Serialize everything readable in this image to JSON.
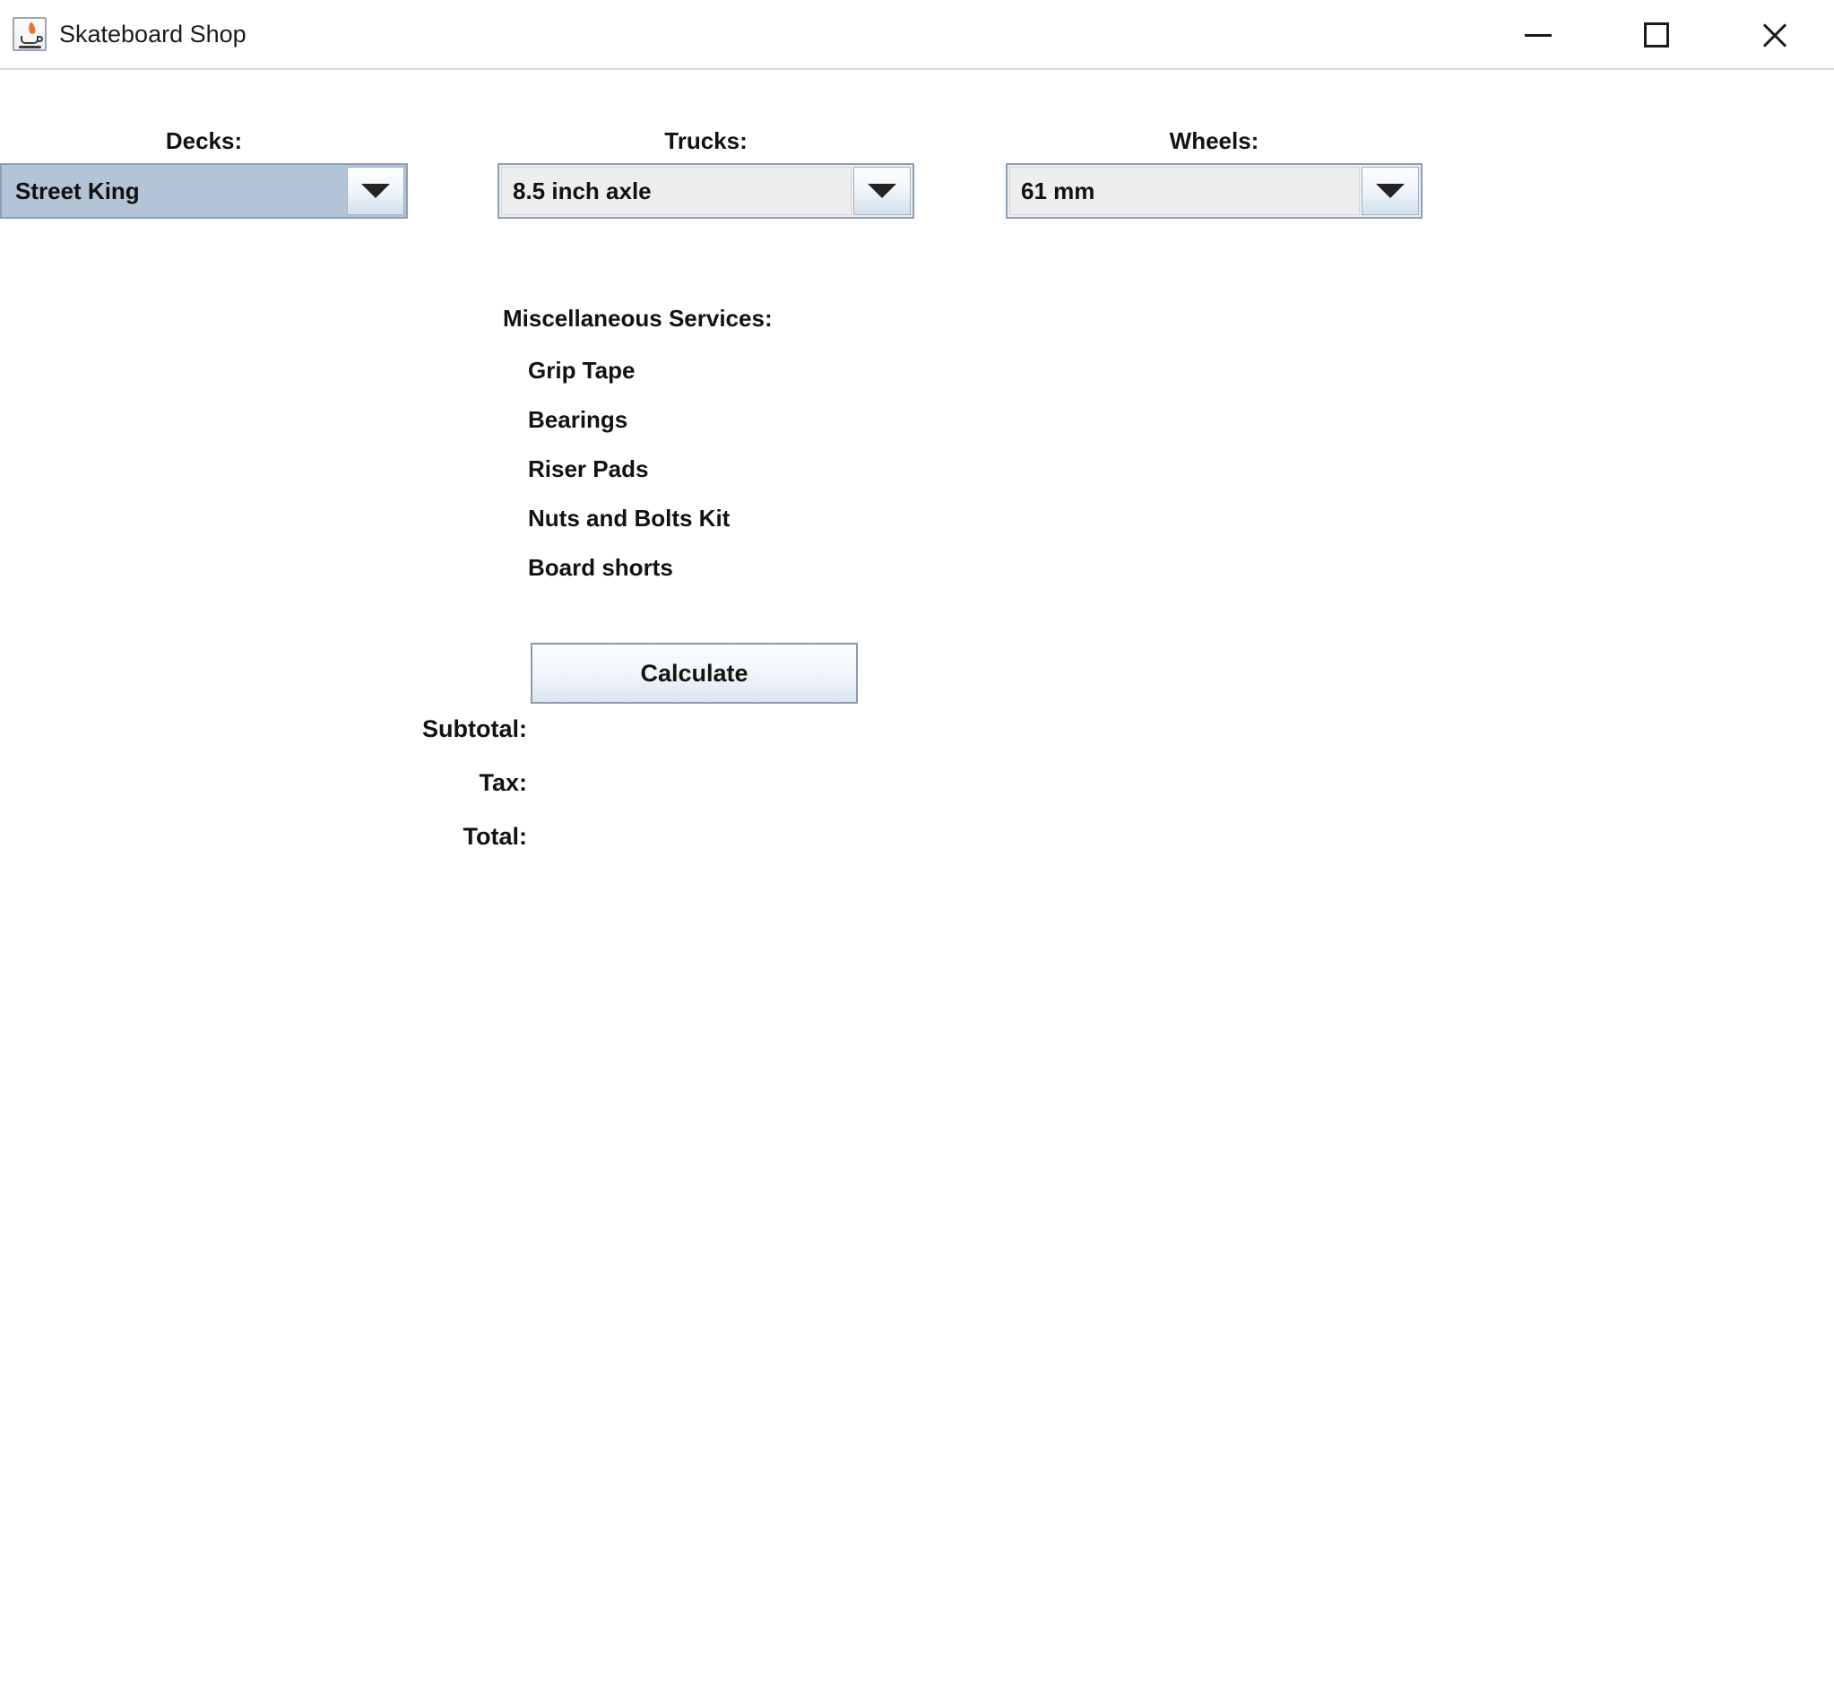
{
  "window": {
    "title": "Skateboard Shop",
    "icon": "java-coffee-cup-icon",
    "controls": {
      "minimize": "—",
      "maximize": "□",
      "close": "✕"
    }
  },
  "form": {
    "decks": {
      "label": "Decks:",
      "selected": "Street King",
      "focused": true
    },
    "trucks": {
      "label": "Trucks:",
      "selected": "8.5 inch axle",
      "focused": false
    },
    "wheels": {
      "label": "Wheels:",
      "selected": "61 mm",
      "focused": false
    }
  },
  "misc_services": {
    "heading": "Miscellaneous Services:",
    "items": [
      {
        "label": "Grip Tape"
      },
      {
        "label": "Bearings"
      },
      {
        "label": "Riser Pads"
      },
      {
        "label": "Nuts and Bolts Kit"
      },
      {
        "label": "Board shorts"
      }
    ]
  },
  "actions": {
    "calculate": "Calculate"
  },
  "totals": [
    {
      "label": "Subtotal:",
      "value": ""
    },
    {
      "label": "Tax:",
      "value": ""
    },
    {
      "label": "Total:",
      "value": ""
    }
  ],
  "colors": {
    "window_bg": "#ffffff",
    "combo_bg": "#eeeeee",
    "combo_focus_bg": "#b2c4d6",
    "combo_border": "#8ba0b6",
    "text": "#121212",
    "title_text": "#1b1b1b",
    "button_border": "#8a9bae"
  }
}
